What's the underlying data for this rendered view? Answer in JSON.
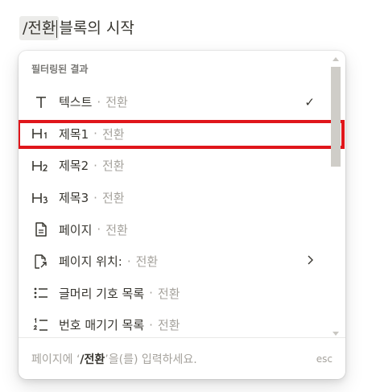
{
  "editor": {
    "slash_text": "/전환",
    "rest_text": "블록의 시작"
  },
  "menu": {
    "section_header": "필터링된 결과",
    "items": [
      {
        "icon": "text-T-icon",
        "label": "텍스트",
        "dot": "·",
        "sub": "전환",
        "right": "✓"
      },
      {
        "icon": "heading1-icon",
        "label": "제목1",
        "dot": "·",
        "sub": "전환",
        "right": ""
      },
      {
        "icon": "heading2-icon",
        "label": "제목2",
        "dot": "·",
        "sub": "전환",
        "right": ""
      },
      {
        "icon": "heading3-icon",
        "label": "제목3",
        "dot": "·",
        "sub": "전환",
        "right": ""
      },
      {
        "icon": "page-icon",
        "label": "페이지",
        "dot": "·",
        "sub": "전환",
        "right": ""
      },
      {
        "icon": "page-move-icon",
        "label": "페이지 위치:",
        "dot": "·",
        "sub": "전환",
        "right": "›"
      },
      {
        "icon": "bulleted-list-icon",
        "label": "글머리 기호 목록",
        "dot": "·",
        "sub": "전환",
        "right": ""
      },
      {
        "icon": "numbered-list-icon",
        "label": "번호 매기기 목록",
        "dot": "·",
        "sub": "전환",
        "right": ""
      }
    ],
    "highlighted_index": 1
  },
  "footer": {
    "prefix": "페이지에 ‘",
    "query": "/전환",
    "suffix": "’을(를) 입력하세요.",
    "esc": "esc"
  }
}
